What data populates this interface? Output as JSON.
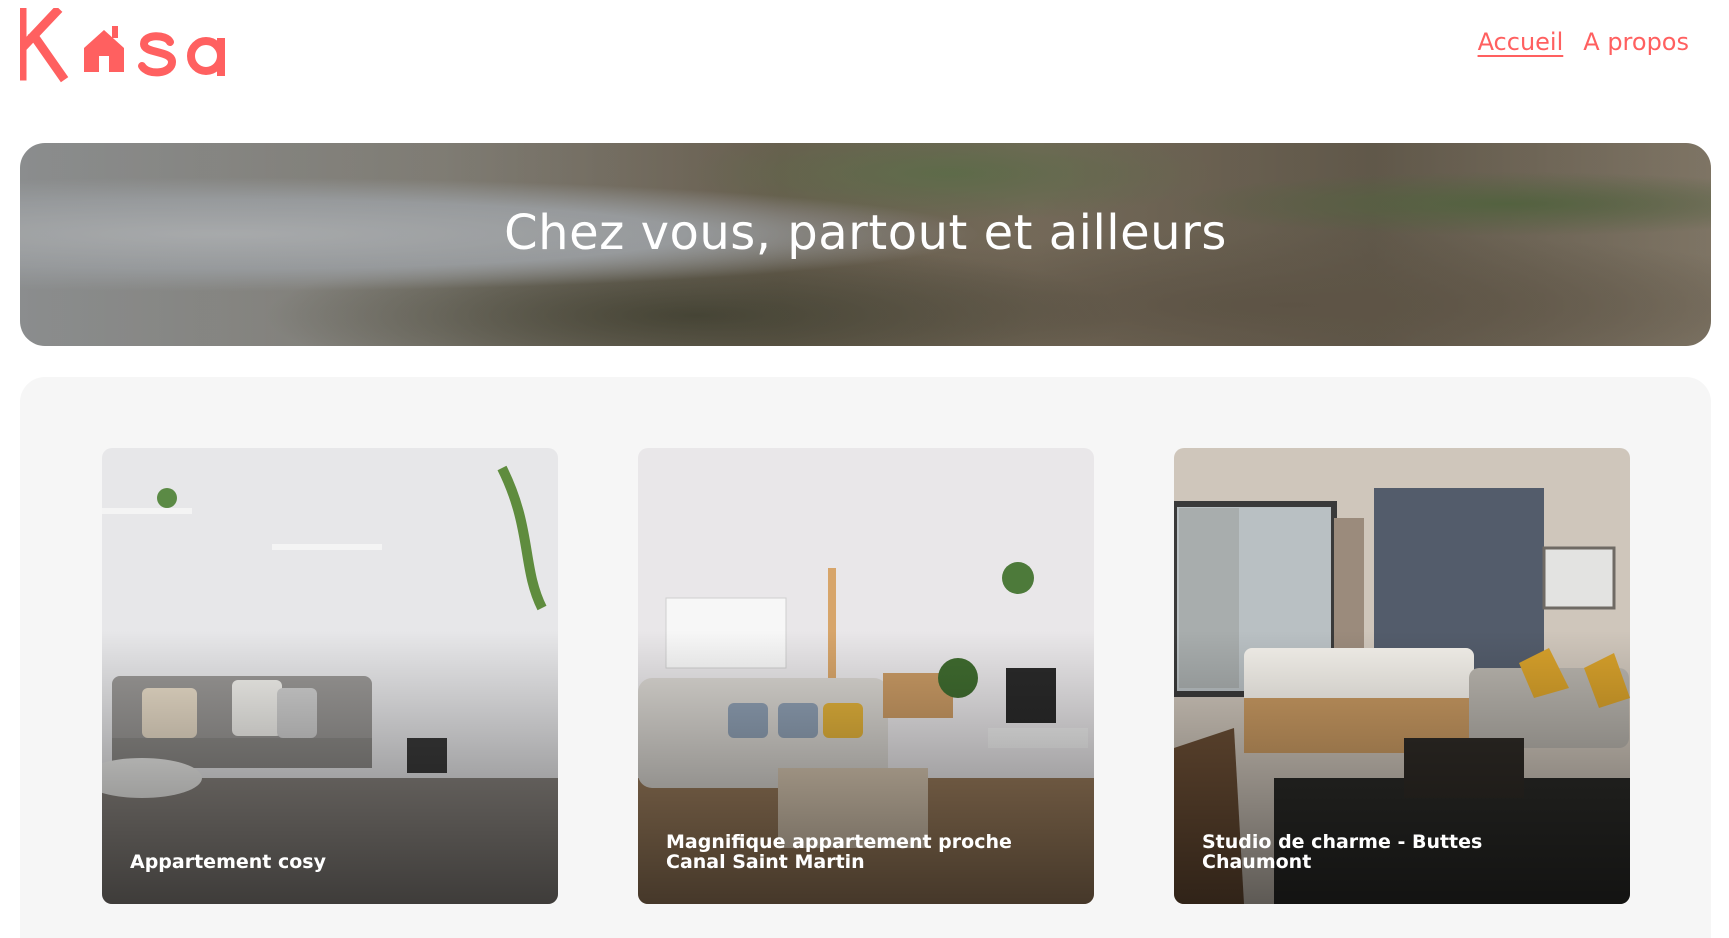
{
  "header": {
    "logo_text": "Kasa",
    "nav": [
      {
        "label": "Accueil",
        "active": true
      },
      {
        "label": "A propos",
        "active": false
      }
    ]
  },
  "banner": {
    "title": "Chez vous, partout et ailleurs"
  },
  "gallery": {
    "cards": [
      {
        "title": "Appartement cosy"
      },
      {
        "title": "Magnifique appartement proche Canal Saint Martin"
      },
      {
        "title": "Studio de charme - Buttes Chaumont"
      }
    ]
  },
  "colors": {
    "brand": "#ff6060",
    "gallery_bg": "#f6f6f6",
    "white": "#ffffff"
  }
}
